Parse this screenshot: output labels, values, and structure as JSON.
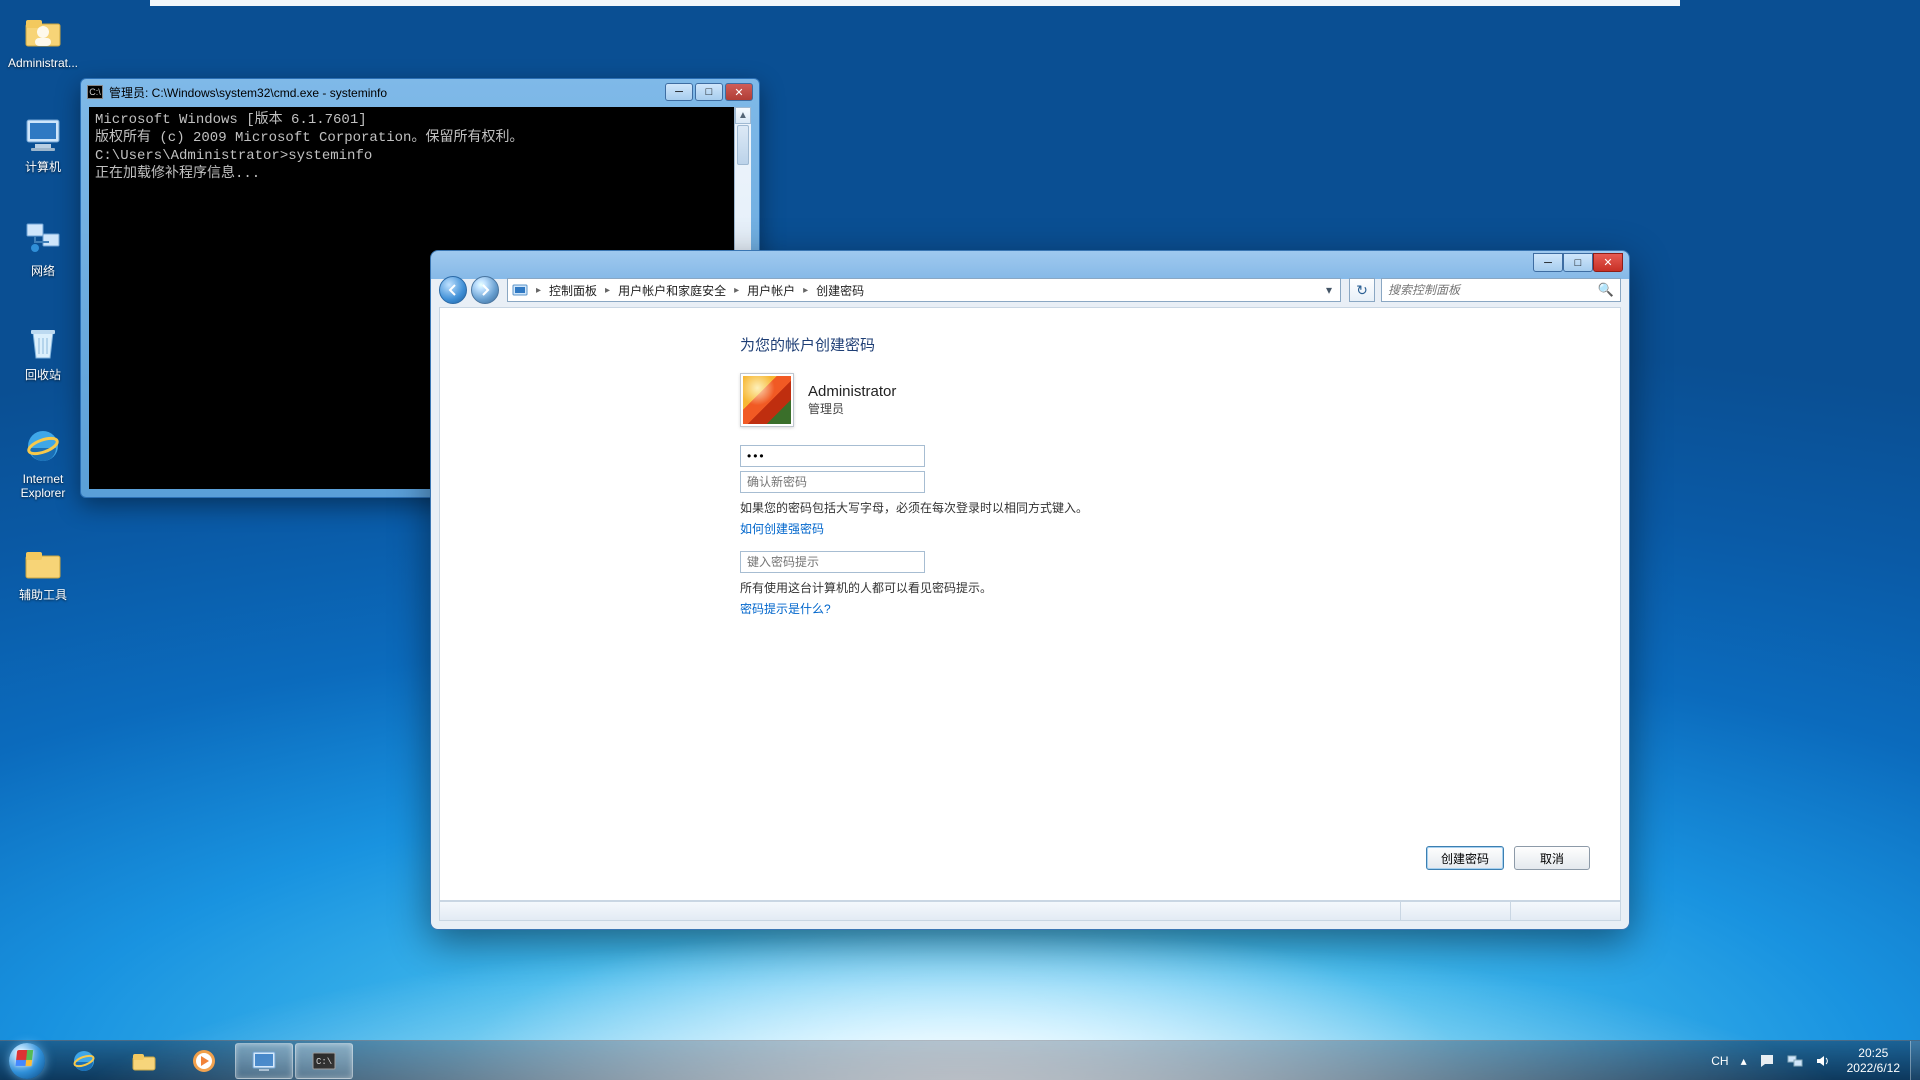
{
  "desktop_icons": [
    {
      "name": "administrator-folder",
      "label": "Administrat..."
    },
    {
      "name": "computer",
      "label": "计算机"
    },
    {
      "name": "network",
      "label": "网络"
    },
    {
      "name": "recycle-bin",
      "label": "回收站"
    },
    {
      "name": "internet-explorer",
      "label": "Internet Explorer"
    },
    {
      "name": "aux-tools-folder",
      "label": "辅助工具"
    }
  ],
  "cmd": {
    "title": "管理员: C:\\Windows\\system32\\cmd.exe - systeminfo",
    "l1": "Microsoft Windows [版本 6.1.7601]",
    "l2": "版权所有 (c) 2009 Microsoft Corporation。保留所有权利。",
    "l3": "",
    "l4": "C:\\Users\\Administrator>systeminfo",
    "l5": "正在加载修补程序信息..."
  },
  "cp": {
    "breadcrumb": {
      "root_icon": "control-panel-icon",
      "seg1": "控制面板",
      "seg2": "用户帐户和家庭安全",
      "seg3": "用户帐户",
      "seg4": "创建密码"
    },
    "search_placeholder": "搜索控制面板",
    "heading": "为您的帐户创建密码",
    "user": {
      "name": "Administrator",
      "role": "管理员"
    },
    "pw_value": "•••",
    "pw_confirm_placeholder": "确认新密码",
    "hint1": "如果您的密码包括大写字母，必须在每次登录时以相同方式键入。",
    "link1": "如何创建强密码",
    "hint_placeholder": "键入密码提示",
    "hint2": "所有使用这台计算机的人都可以看见密码提示。",
    "link2": "密码提示是什么?",
    "btn_create": "创建密码",
    "btn_cancel": "取消"
  },
  "tray": {
    "ime": "CH",
    "time": "20:25",
    "date": "2022/6/12"
  }
}
